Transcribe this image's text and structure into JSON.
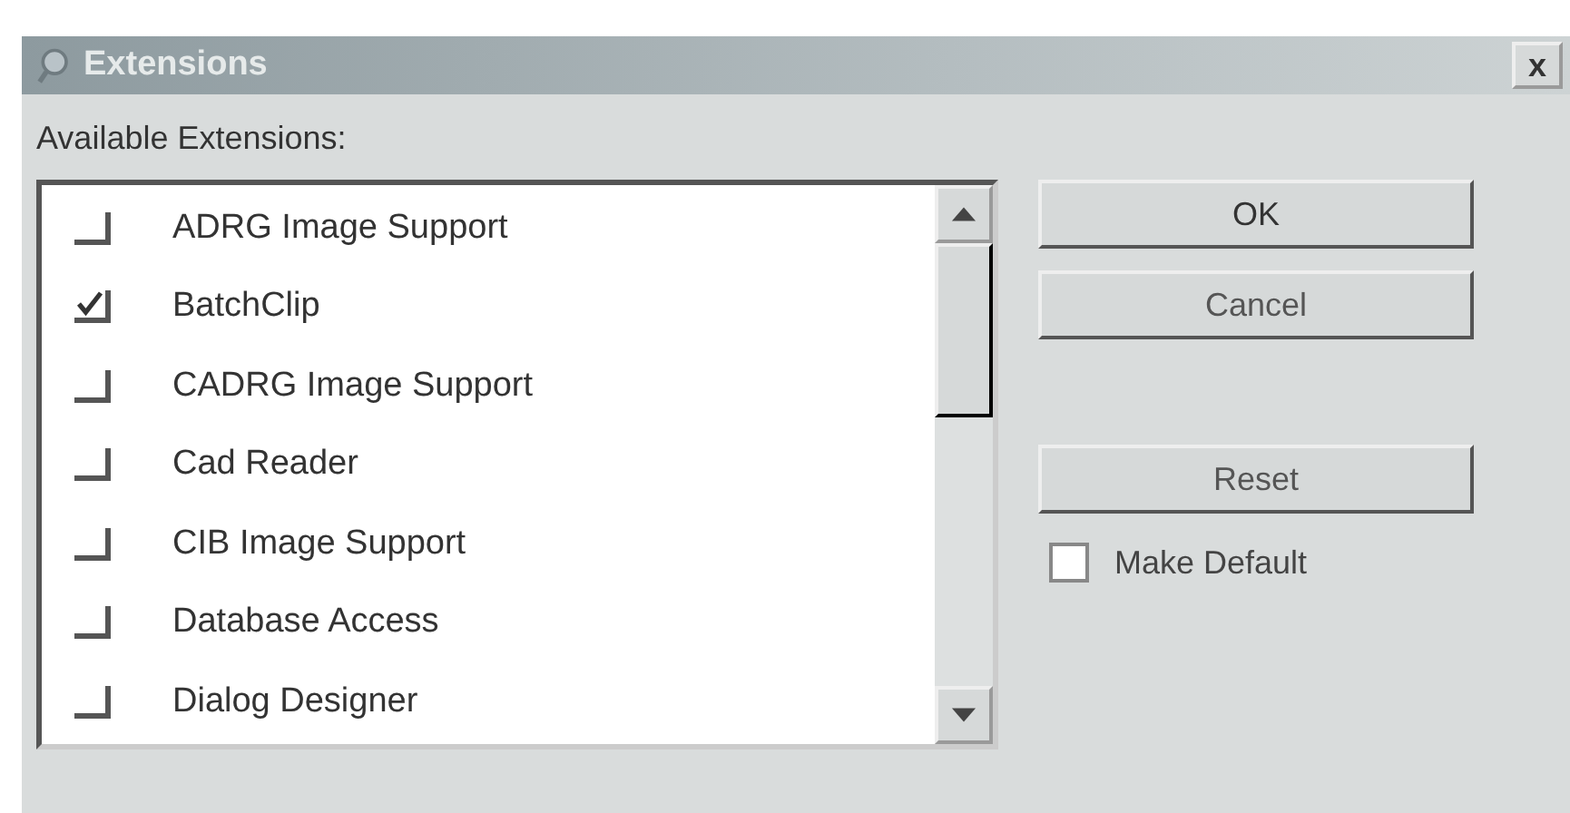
{
  "window": {
    "title": "Extensions",
    "close": "x"
  },
  "list_label": "Available Extensions:",
  "extensions": [
    {
      "name": "ADRG Image Support",
      "checked": false
    },
    {
      "name": "BatchClip",
      "checked": true
    },
    {
      "name": "CADRG Image Support",
      "checked": false
    },
    {
      "name": "Cad Reader",
      "checked": false
    },
    {
      "name": "CIB Image Support",
      "checked": false
    },
    {
      "name": "Database Access",
      "checked": false
    },
    {
      "name": "Dialog Designer",
      "checked": false
    }
  ],
  "buttons": [
    {
      "label": "OK",
      "kind": "primary"
    },
    {
      "label": "Cancel",
      "kind": "normal"
    },
    {
      "label": "Reset",
      "kind": "spaced"
    }
  ],
  "make_default": {
    "label": "Make Default",
    "checked": false
  }
}
